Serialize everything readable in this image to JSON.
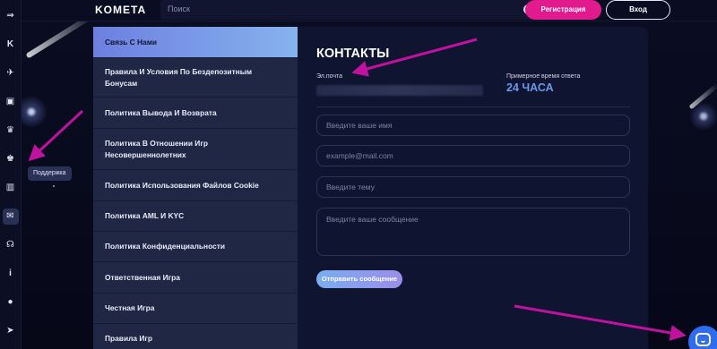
{
  "header": {
    "logo": "KOMETA",
    "search_placeholder": "Поиск",
    "register_label": "Регистрация",
    "login_label": "Вход"
  },
  "sidebar": {
    "items": [
      {
        "icon": "expand-arrow-icon",
        "glyph": "⇒"
      },
      {
        "icon": "k-logo-icon",
        "glyph": "K"
      },
      {
        "icon": "rocket-icon",
        "glyph": "✈"
      },
      {
        "icon": "cards-icon",
        "glyph": "▣"
      },
      {
        "icon": "crown-icon",
        "glyph": "♛"
      },
      {
        "icon": "trophy-icon",
        "glyph": "♚"
      },
      {
        "icon": "tournament-icon",
        "glyph": "▥"
      },
      {
        "icon": "support-icon",
        "glyph": "✉"
      },
      {
        "icon": "headset-icon",
        "glyph": "☊"
      },
      {
        "icon": "info-icon",
        "glyph": "i"
      },
      {
        "icon": "language-flag-icon",
        "glyph": "●"
      },
      {
        "icon": "telegram-icon",
        "glyph": "➤"
      }
    ],
    "tooltip": "Поддержка"
  },
  "menu": {
    "items": [
      {
        "label": "Связь С Нами",
        "active": true,
        "height": 35
      },
      {
        "label": "Правила И Условия По Бездепозитным Бонусам",
        "active": false,
        "height": 44
      },
      {
        "label": "Политика Вывода И Возврата",
        "active": false,
        "height": 35
      },
      {
        "label": "Политика В Отношении Игр Несовершеннолетних",
        "active": false,
        "height": 46
      },
      {
        "label": "Политика Использования Файлов Cookie",
        "active": false,
        "height": 35
      },
      {
        "label": "Политика AML И KYC",
        "active": false,
        "height": 34
      },
      {
        "label": "Политика Конфиденциальности",
        "active": false,
        "height": 34
      },
      {
        "label": "Ответственная Игра",
        "active": false,
        "height": 35
      },
      {
        "label": "Честная Игра",
        "active": false,
        "height": 34
      },
      {
        "label": "Правила Игр",
        "active": false,
        "height": 34
      }
    ]
  },
  "contacts": {
    "title": "КОНТАКТЫ",
    "email_label": "Эл.почта",
    "response_label": "Примерное время ответа",
    "response_value": "24 ЧАСА",
    "form": {
      "name_placeholder": "Введите ваше имя",
      "email_placeholder": "example@mail.com",
      "subject_placeholder": "Введите тему",
      "message_placeholder": "Введите ваше сообщение",
      "submit_label": "Отправить сообщение"
    }
  },
  "colors": {
    "accent_pink": "#e21a8e",
    "accent_blue": "#6e97e8",
    "arrow_magenta": "#c0129e",
    "chat_blue": "#2f6cf0"
  }
}
